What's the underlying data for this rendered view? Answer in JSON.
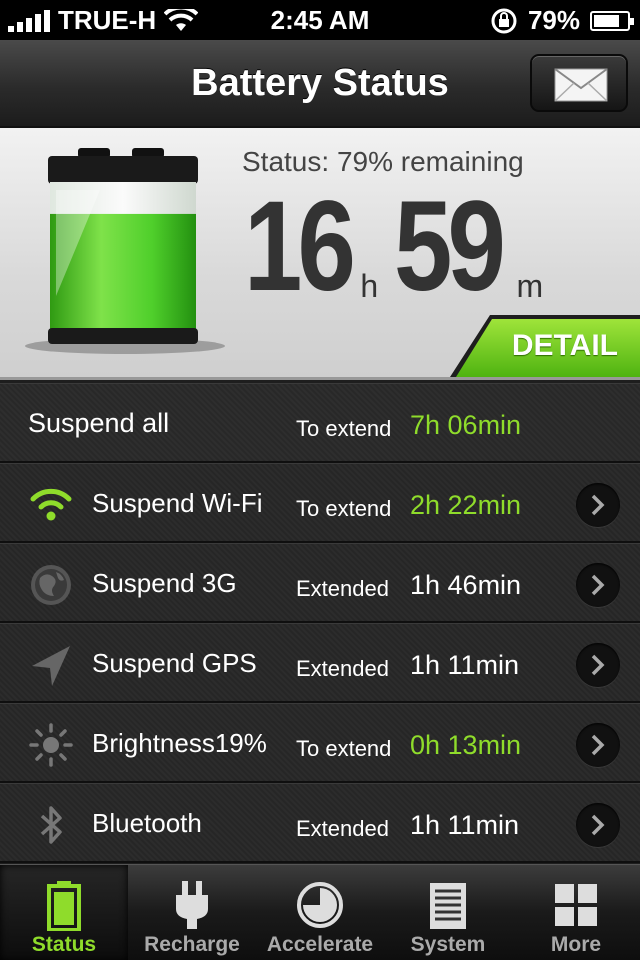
{
  "status_bar": {
    "carrier": "TRUE-H",
    "time": "2:45 AM",
    "battery_percent": "79%",
    "battery_level": 0.79
  },
  "nav": {
    "title": "Battery Status",
    "mail_icon": "envelope-icon"
  },
  "hero": {
    "status_text": "Status: 79% remaining",
    "hours": "16",
    "hours_unit": "h",
    "minutes": "59",
    "minutes_unit": "m",
    "battery_level": 0.79,
    "detail_label": "DETAIL",
    "accent": "#7ed321"
  },
  "rows": [
    {
      "label": "Suspend all",
      "hint": "To extend",
      "value": "7h 06min",
      "highlight": true,
      "icon": null
    },
    {
      "label": "Suspend Wi-Fi",
      "hint": "To extend",
      "value": "2h 22min",
      "highlight": true,
      "icon": "wifi-icon"
    },
    {
      "label": "Suspend 3G",
      "hint": "Extended",
      "value": "1h 46min",
      "highlight": false,
      "icon": "globe-icon"
    },
    {
      "label": "Suspend GPS",
      "hint": "Extended",
      "value": "1h 11min",
      "highlight": false,
      "icon": "location-arrow-icon"
    },
    {
      "label": "Brightness19%",
      "hint": "To extend",
      "value": "0h 13min",
      "highlight": true,
      "icon": "sun-icon"
    },
    {
      "label": "Bluetooth",
      "hint": "Extended",
      "value": "1h 11min",
      "highlight": false,
      "icon": "bluetooth-icon"
    }
  ],
  "tabs": [
    {
      "label": "Status",
      "icon": "battery-icon",
      "active": true
    },
    {
      "label": "Recharge",
      "icon": "plug-icon",
      "active": false
    },
    {
      "label": "Accelerate",
      "icon": "pie-chart-icon",
      "active": false
    },
    {
      "label": "System",
      "icon": "document-icon",
      "active": false
    },
    {
      "label": "More",
      "icon": "grid-icon",
      "active": false
    }
  ]
}
